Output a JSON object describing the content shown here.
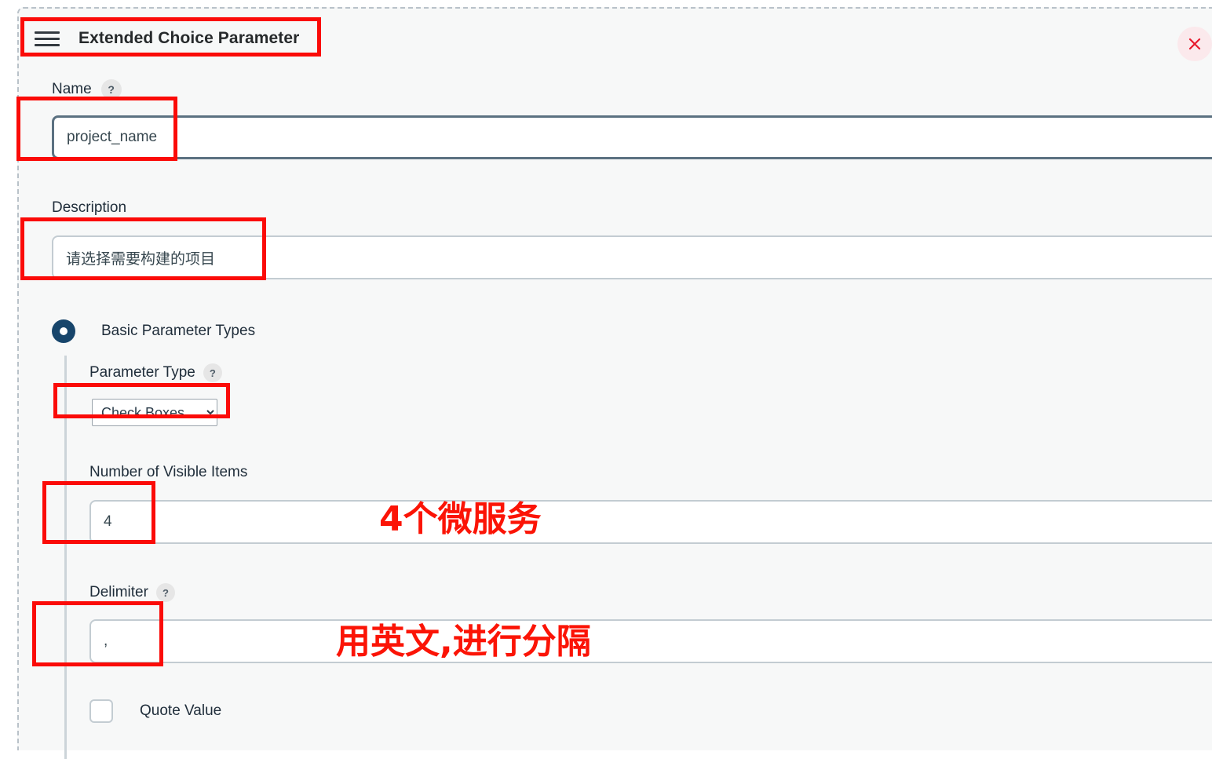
{
  "panel": {
    "title": "Extended Choice Parameter",
    "menu_icon": "hamburger-icon",
    "close_icon": "close-icon"
  },
  "form": {
    "name": {
      "label": "Name",
      "help": "?",
      "value": "project_name"
    },
    "description": {
      "label": "Description",
      "value": "请选择需要构建的项目"
    },
    "parameter_mode": {
      "label": "Basic Parameter Types",
      "selected": true
    },
    "parameter_type": {
      "label": "Parameter Type",
      "help": "?",
      "value": "Check Boxes",
      "options": [
        "Check Boxes"
      ]
    },
    "visible_items": {
      "label": "Number of Visible Items",
      "value": "4"
    },
    "delimiter": {
      "label": "Delimiter",
      "help": "?",
      "value": ","
    },
    "quote_value": {
      "label": "Quote Value",
      "checked": false
    }
  },
  "annotations": {
    "visible_items_note": "4个微服务",
    "delimiter_note": "用英文,进行分隔",
    "highlight_color": "#fb0b08",
    "note_color": "#fb1406"
  }
}
